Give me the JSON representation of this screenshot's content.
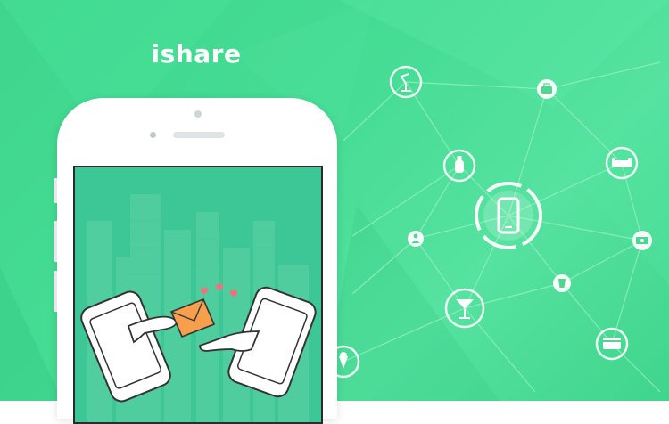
{
  "app": {
    "title": "ishare"
  },
  "colors": {
    "background": "#45dc94",
    "screen": "#3ec796",
    "node_fill": "#ffffff",
    "node_icon": "#4fd68f",
    "link": "#8ff0bd",
    "heart": "#ff6b7a",
    "envelope": "#f6a04d"
  },
  "network": {
    "center_icon": "smartphone-icon",
    "nodes": [
      "desk-lamp-icon",
      "briefcase-icon",
      "bottle-icon",
      "sofa-icon",
      "person-icon",
      "cash-icon",
      "cocktail-icon",
      "drink-cup-icon",
      "credit-card-icon",
      "ice-cream-icon"
    ]
  }
}
